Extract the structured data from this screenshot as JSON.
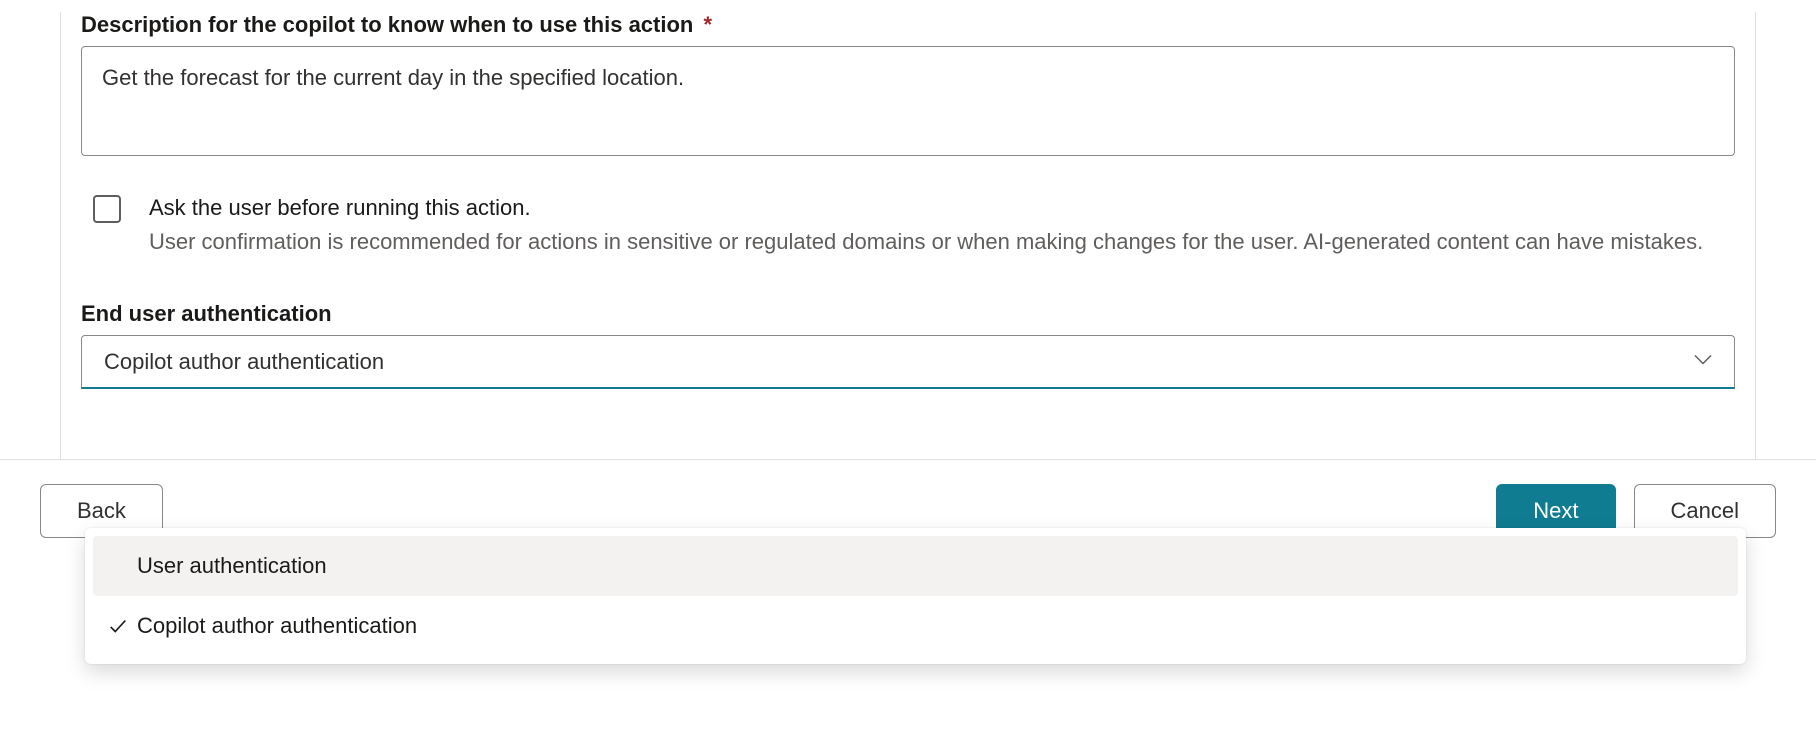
{
  "description": {
    "label": "Description for the copilot to know when to use this action",
    "required_marker": "*",
    "value": "Get the forecast for the current day in the specified location."
  },
  "confirm": {
    "checked": false,
    "primary_text": "Ask the user before running this action.",
    "secondary_text": "User confirmation is recommended for actions in sensitive or regulated domains or when making changes for the user. AI-generated content can have mistakes."
  },
  "auth": {
    "label": "End user authentication",
    "selected": "Copilot author authentication",
    "options": [
      {
        "label": "User authentication",
        "selected": false,
        "hover": true
      },
      {
        "label": "Copilot author authentication",
        "selected": true,
        "hover": false
      }
    ]
  },
  "buttons": {
    "back": "Back",
    "next": "Next",
    "cancel": "Cancel"
  }
}
